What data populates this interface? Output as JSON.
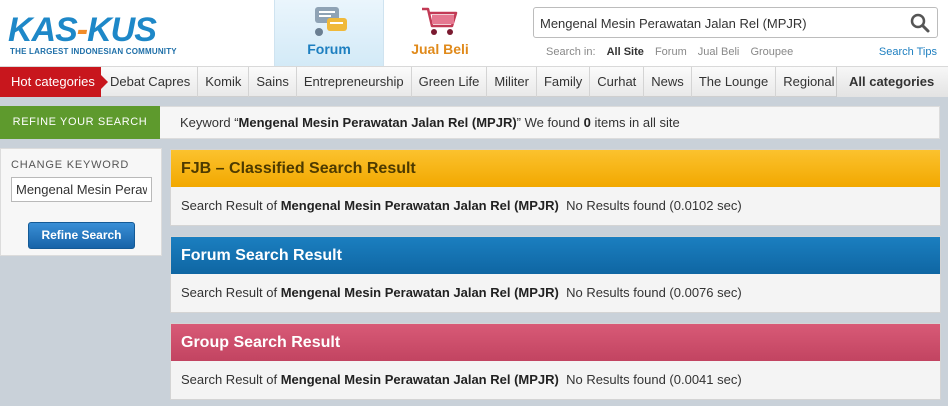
{
  "logo": {
    "wordmark_a": "KAS",
    "wordmark_dash": "-",
    "wordmark_b": "KUS",
    "tagline": "THE LARGEST INDONESIAN COMMUNITY"
  },
  "top_tabs": [
    {
      "label": "Forum",
      "icon": "forum-icon",
      "active": true
    },
    {
      "label": "Jual Beli",
      "icon": "shopping-cart-icon",
      "active": false
    }
  ],
  "search": {
    "value": "Mengenal Mesin Perawatan Jalan Rel (MPJR)",
    "scope_label": "Search in:",
    "scopes": [
      "All Site",
      "Forum",
      "Jual Beli",
      "Groupee"
    ],
    "active_scope": "All Site",
    "tips": "Search Tips"
  },
  "nav": {
    "hot": "Hot categories",
    "items": [
      "Debat Capres",
      "Komik",
      "Sains",
      "Entrepreneurship",
      "Green Life",
      "Militer",
      "Family",
      "Curhat",
      "News",
      "The Lounge",
      "Regional"
    ],
    "all": "All categories"
  },
  "refine": {
    "tab": "REFINE YOUR SEARCH",
    "keyword_prefix": "Keyword “",
    "keyword": "Mengenal Mesin Perawatan Jalan Rel (MPJR)",
    "keyword_mid": "” We found ",
    "count": "0",
    "keyword_suffix": " items in all site"
  },
  "change_keyword": {
    "label": "CHANGE KEYWORD",
    "value": "Mengenal Mesin Perawatan Jalan Rel (MPJR)",
    "button": "Refine Search"
  },
  "results": [
    {
      "title": "FJB – Classified Search Result",
      "prefix": "Search Result of ",
      "keyword": "Mengenal Mesin Perawatan Jalan Rel (MPJR)",
      "status": "  No Results found (0.0102 sec)"
    },
    {
      "title": "Forum Search Result",
      "prefix": "Search Result of ",
      "keyword": "Mengenal Mesin Perawatan Jalan Rel (MPJR)",
      "status": "  No Results found (0.0076 sec)"
    },
    {
      "title": "Group Search Result",
      "prefix": "Search Result of ",
      "keyword": "Mengenal Mesin Perawatan Jalan Rel (MPJR)",
      "status": "  No Results found (0.0041 sec)"
    }
  ],
  "colors": {
    "brand_blue": "#1e88c8",
    "brand_orange": "#f28c28",
    "hot_red": "#c8161d",
    "refine_green": "#5e9a2d",
    "fjb_yellow": "#f2a800",
    "forum_blue": "#0f66a3",
    "group_pink": "#c24461"
  }
}
